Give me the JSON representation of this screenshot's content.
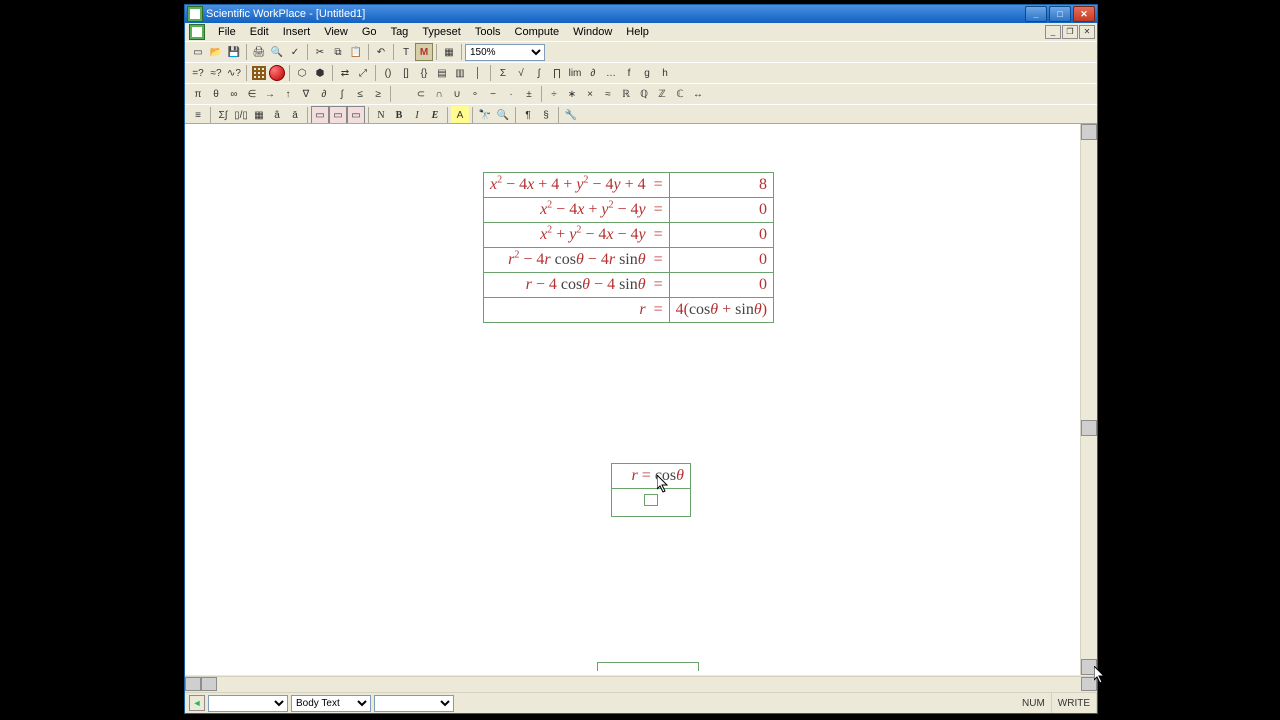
{
  "title": "Scientific WorkPlace - [Untitled1]",
  "menus": [
    "File",
    "Edit",
    "Insert",
    "View",
    "Go",
    "Tag",
    "Typeset",
    "Tools",
    "Compute",
    "Window",
    "Help"
  ],
  "zoom": "150%",
  "style_select": "Body Text",
  "status": {
    "num": "NUM",
    "write": "WRITE"
  },
  "eq_rows": [
    {
      "lhs": "x² − 4x + 4 + y² − 4y + 4",
      "rhs": "8"
    },
    {
      "lhs": "x² − 4x + y² − 4y",
      "rhs": "0"
    },
    {
      "lhs": "x² + y² − 4x − 4y",
      "rhs": "0"
    },
    {
      "lhs": "r² − 4r cosθ − 4r sinθ",
      "rhs": "0"
    },
    {
      "lhs": "r − 4 cosθ − 4 sinθ",
      "rhs": "0"
    },
    {
      "lhs": "r",
      "rhs": "4(cosθ + sinθ)"
    }
  ],
  "eq_small": "r = cosθ",
  "toolbar_row2_chars": [
    "?",
    "?",
    "?",
    "",
    "",
    "",
    "",
    "",
    "",
    "",
    "",
    "",
    "",
    "",
    "",
    "",
    "",
    "",
    "",
    "",
    "",
    "",
    "",
    "",
    "",
    "",
    ""
  ],
  "toolbar_row3_chars": [
    "π",
    "θ",
    "∞",
    "∈",
    "→",
    "↑",
    "∇",
    "∂",
    "∫",
    "≤",
    "≥",
    "",
    "⊂",
    "∩",
    "∪",
    "∘",
    "−",
    "·",
    "±",
    "÷",
    "∗",
    "×",
    "≈",
    "ℝ",
    "ℚ",
    "ℤ",
    "ℂ",
    "↔"
  ],
  "toolbar_row4_labels": [
    "N",
    "B",
    "I",
    "E"
  ]
}
